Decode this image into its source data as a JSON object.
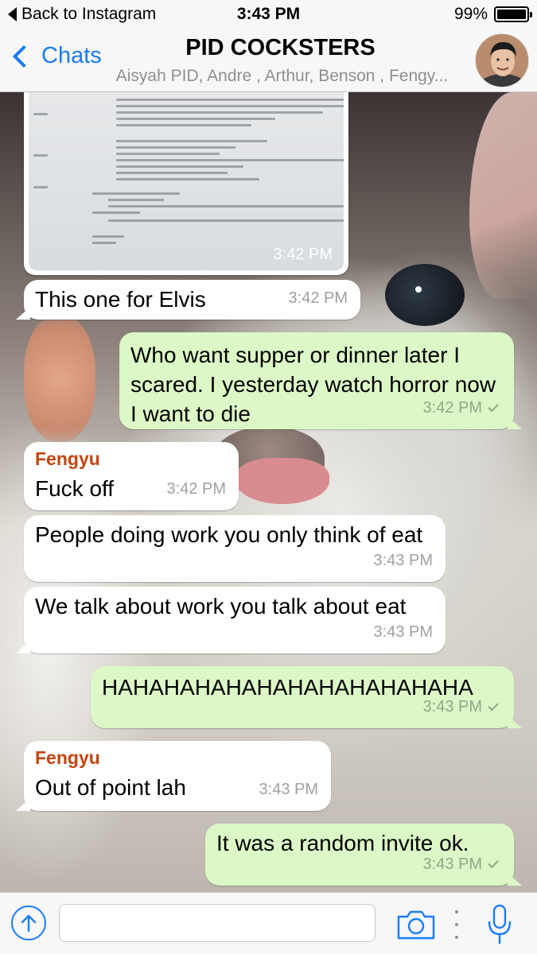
{
  "status_bar": {
    "back_label": "Back to Instagram",
    "time": "3:43 PM",
    "battery": "99%",
    "battery_level": 0.99
  },
  "nav": {
    "back_label": "Chats",
    "title": "PID COCKSTERS",
    "subtitle": "Aisyah PID, Andre , Arthur, Benson , Fengy..."
  },
  "messages": [
    {
      "type": "image",
      "direction": "in",
      "time": "3:42 PM"
    },
    {
      "direction": "in",
      "text": "This one for Elvis",
      "time": "3:42 PM"
    },
    {
      "direction": "out",
      "text": "Who want supper or dinner later I scared. I yesterday watch horror now I want to die",
      "time": "3:42 PM"
    },
    {
      "direction": "in",
      "sender": "Fengyu",
      "text": "Fuck off",
      "time": "3:42 PM"
    },
    {
      "direction": "in",
      "text": "People doing work you only think of eat",
      "time": "3:43 PM"
    },
    {
      "direction": "in",
      "text": "We talk about work you talk about eat",
      "time": "3:43 PM"
    },
    {
      "direction": "out",
      "text": "HAHAHAHAHAHAHAHAHAHAHAHA",
      "time": "3:43 PM"
    },
    {
      "direction": "in",
      "sender": "Fengyu",
      "text": "Out of point lah",
      "time": "3:43 PM"
    },
    {
      "direction": "out",
      "text": "It was a random invite ok.",
      "time": "3:43 PM"
    }
  ],
  "input_bar": {
    "placeholder": ""
  },
  "icons": {
    "upload": "upload-icon",
    "camera": "camera-icon",
    "more": "more-dots-icon",
    "mic": "microphone-icon"
  },
  "colors": {
    "accent": "#1a7cf5",
    "outgoing_bubble": "#dcf8c6",
    "incoming_bubble": "#ffffff",
    "sender_name": "#c44510"
  }
}
